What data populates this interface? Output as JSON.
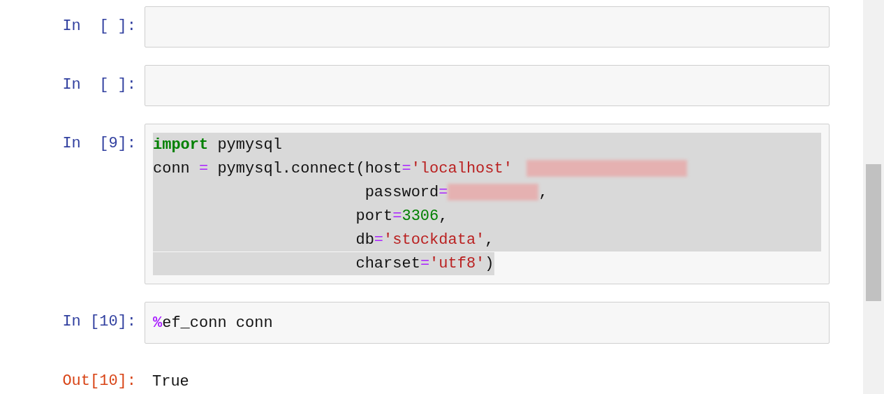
{
  "cells": [
    {
      "kind": "input",
      "prompt": "In  [ ]:"
    },
    {
      "kind": "input",
      "prompt": "In  [ ]:"
    },
    {
      "kind": "input",
      "prompt": "In  [9]:",
      "lines": [
        {
          "highlighted": true,
          "full_width": true,
          "tokens": [
            {
              "kind": "keyword",
              "text": "import"
            },
            {
              "kind": "plain",
              "text": " pymysql"
            }
          ]
        },
        {
          "highlighted": true,
          "full_width": true,
          "tokens": [
            {
              "kind": "plain",
              "text": "conn "
            },
            {
              "kind": "op",
              "text": "="
            },
            {
              "kind": "plain",
              "text": " pymysql.connect(host"
            },
            {
              "kind": "op",
              "text": "="
            },
            {
              "kind": "string",
              "text": "'localhost'"
            },
            {
              "kind": "redacted"
            }
          ]
        },
        {
          "highlighted": true,
          "full_width": true,
          "tokens": [
            {
              "kind": "plain",
              "text": "                       password"
            },
            {
              "kind": "op",
              "text": "="
            },
            {
              "kind": "redacted"
            },
            {
              "kind": "plain",
              "text": ","
            }
          ]
        },
        {
          "highlighted": true,
          "full_width": true,
          "tokens": [
            {
              "kind": "plain",
              "text": "                      port"
            },
            {
              "kind": "op",
              "text": "="
            },
            {
              "kind": "number",
              "text": "3306"
            },
            {
              "kind": "plain",
              "text": ","
            }
          ]
        },
        {
          "highlighted": true,
          "full_width": true,
          "tokens": [
            {
              "kind": "plain",
              "text": "                      db"
            },
            {
              "kind": "op",
              "text": "="
            },
            {
              "kind": "string",
              "text": "'stockdata'"
            },
            {
              "kind": "plain",
              "text": ","
            }
          ]
        },
        {
          "highlighted": true,
          "full_width": false,
          "tokens": [
            {
              "kind": "plain",
              "text": "                      charset"
            },
            {
              "kind": "op",
              "text": "="
            },
            {
              "kind": "string",
              "text": "'utf8'"
            },
            {
              "kind": "plain",
              "text": ")"
            }
          ]
        }
      ]
    },
    {
      "kind": "input",
      "prompt": "In [10]:",
      "lines": [
        {
          "highlighted": false,
          "tokens": [
            {
              "kind": "magic",
              "text": "%"
            },
            {
              "kind": "plain",
              "text": "ef_conn conn"
            }
          ]
        }
      ]
    },
    {
      "kind": "output",
      "prompt": "Out[10]:",
      "lines": [
        {
          "highlighted": false,
          "tokens": [
            {
              "kind": "plain",
              "text": "True"
            }
          ]
        }
      ]
    }
  ]
}
